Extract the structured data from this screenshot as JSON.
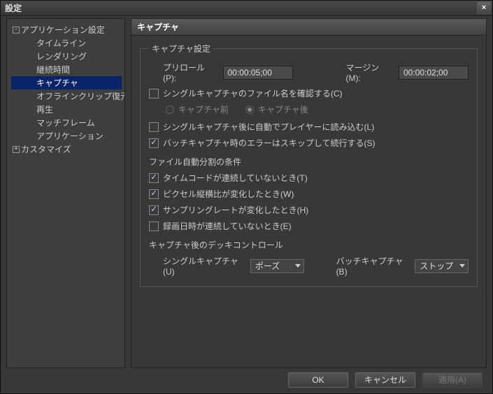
{
  "window": {
    "title": "設定",
    "close": "×"
  },
  "tree": {
    "root1": "アプリケーション設定",
    "items": [
      "タイムライン",
      "レンダリング",
      "継続時間",
      "キャプチャ",
      "オフラインクリップ復元",
      "再生",
      "マッチフレーム",
      "アプリケーション"
    ],
    "root2": "カスタマイズ"
  },
  "section_title": "キャプチャ",
  "fieldset_legend": "キャプチャ設定",
  "preroll": {
    "label": "プリロール(P):",
    "value": "00:00:05;00"
  },
  "margin": {
    "label": "マージン(M):",
    "value": "00:00:02;00"
  },
  "chk_confirm": {
    "label": "シングルキャプチャのファイル名を確認する(C)",
    "checked": false
  },
  "radio_before": "キャプチャ前",
  "radio_after": "キャプチャ後",
  "chk_autoload": {
    "label": "シングルキャプチャ後に自動でプレイヤーに読み込む(L)",
    "checked": false
  },
  "chk_skiperr": {
    "label": "バッチキャプチャ時のエラーはスキップして続行する(S)",
    "checked": true
  },
  "split_header": "ファイル自動分割の条件",
  "split_tc": {
    "label": "タイムコードが連続していないとき(T)",
    "checked": true
  },
  "split_pixel": {
    "label": "ピクセル縦横比が変化したとき(W)",
    "checked": true
  },
  "split_rate": {
    "label": "サンプリングレートが変化したとき(H)",
    "checked": true
  },
  "split_date": {
    "label": "録画日時が連続していないとき(E)",
    "checked": false
  },
  "deck_header": "キャプチャ後のデッキコントロール",
  "deck_single": {
    "label": "シングルキャプチャ(U)",
    "value": "ポーズ"
  },
  "deck_batch": {
    "label": "バッチキャプチャ(B)",
    "value": "ストップ"
  },
  "buttons": {
    "ok": "OK",
    "cancel": "キャンセル",
    "apply": "適用(A)"
  }
}
